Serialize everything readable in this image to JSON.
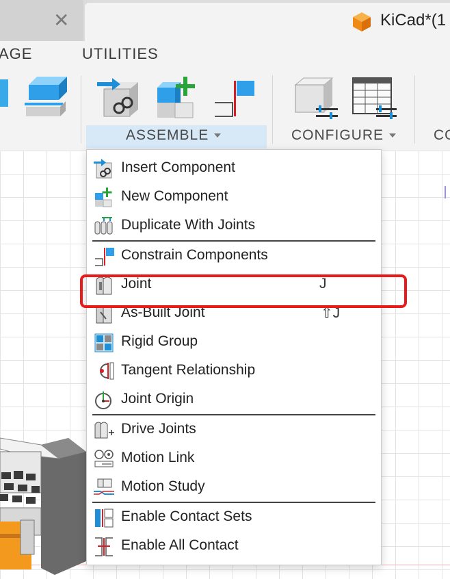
{
  "window": {
    "close_glyph": "✕",
    "doc_title": "KiCad*(1"
  },
  "ribbon": {
    "tabs": [
      "AGE",
      "UTILITIES"
    ],
    "groups": {
      "assemble": "ASSEMBLE",
      "configure": "CONFIGURE",
      "next": "CO"
    }
  },
  "menu": {
    "items": [
      {
        "label": "Insert Component",
        "icon": "insert-component-icon",
        "shortcut": ""
      },
      {
        "label": "New Component",
        "icon": "new-component-icon",
        "shortcut": ""
      },
      {
        "label": "Duplicate With Joints",
        "icon": "duplicate-with-joints-icon",
        "shortcut": ""
      },
      {
        "label": "Constrain Components",
        "icon": "constrain-components-icon",
        "shortcut": ""
      },
      {
        "label": "Joint",
        "icon": "joint-icon",
        "shortcut": "J"
      },
      {
        "label": "As-Built Joint",
        "icon": "as-built-joint-icon",
        "shortcut": "⇧J"
      },
      {
        "label": "Rigid Group",
        "icon": "rigid-group-icon",
        "shortcut": ""
      },
      {
        "label": "Tangent Relationship",
        "icon": "tangent-relationship-icon",
        "shortcut": ""
      },
      {
        "label": "Joint Origin",
        "icon": "joint-origin-icon",
        "shortcut": ""
      },
      {
        "label": "Drive Joints",
        "icon": "drive-joints-icon",
        "shortcut": ""
      },
      {
        "label": "Motion Link",
        "icon": "motion-link-icon",
        "shortcut": ""
      },
      {
        "label": "Motion Study",
        "icon": "motion-study-icon",
        "shortcut": ""
      },
      {
        "label": "Enable Contact Sets",
        "icon": "enable-contact-sets-icon",
        "shortcut": ""
      },
      {
        "label": "Enable All Contact",
        "icon": "enable-all-contact-icon",
        "shortcut": ""
      }
    ]
  },
  "colors": {
    "accent_blue": "#1e8fd6",
    "accent_green": "#2aa33a",
    "highlight_red": "#e81a1a",
    "group_highlight": "#d7e9f7",
    "model_orange": "#f39a1e"
  }
}
